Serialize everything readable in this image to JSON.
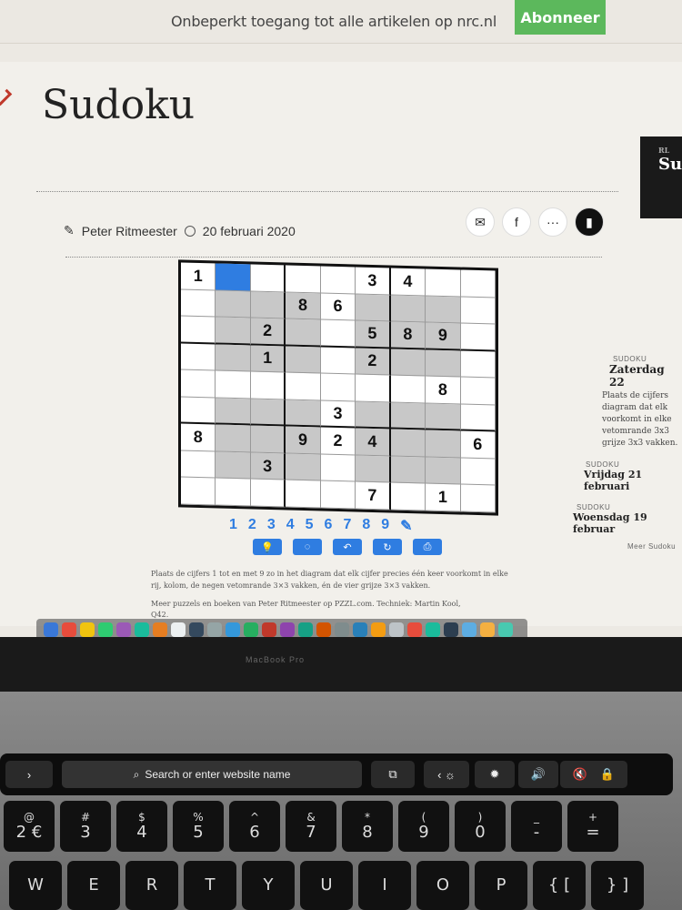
{
  "promo": {
    "text": "Onbeperkt toegang tot alle artikelen op nrc.nl",
    "button": "Abonneer"
  },
  "article": {
    "title": "Sudoku",
    "author": "Peter Ritmeester",
    "date": "20 februari 2020"
  },
  "share": {
    "mail": "✉",
    "facebook": "f",
    "more": "···",
    "bookmark": "▮"
  },
  "sudoku": {
    "cells": [
      [
        "1",
        "",
        "",
        "",
        "",
        "3",
        "4",
        "",
        ""
      ],
      [
        "",
        "",
        "",
        "8",
        "6",
        "",
        "",
        "",
        ""
      ],
      [
        "",
        "",
        "2",
        "",
        "",
        "5",
        "8",
        "9",
        ""
      ],
      [
        "",
        "",
        "1",
        "",
        "",
        "2",
        "",
        "",
        ""
      ],
      [
        "",
        "",
        "",
        "",
        "",
        "",
        "",
        "8",
        ""
      ],
      [
        "",
        "",
        "",
        "",
        "3",
        "",
        "",
        "",
        ""
      ],
      [
        "8",
        "",
        "",
        "9",
        "2",
        "4",
        "",
        "",
        "6"
      ],
      [
        "",
        "",
        "3",
        "",
        "",
        "",
        "",
        "",
        ""
      ],
      [
        "",
        "",
        "",
        "",
        "",
        "7",
        "",
        "1",
        ""
      ]
    ],
    "digits": [
      "1",
      "2",
      "3",
      "4",
      "5",
      "6",
      "7",
      "8",
      "9",
      "✎"
    ],
    "tools": [
      "💡",
      "◌",
      "↶",
      "↻",
      "⎙"
    ]
  },
  "instructions": "Plaats de cijfers 1 tot en met 9 zo in het diagram dat elk cijfer precies één keer voorkomt in elke rij, kolom, de negen vetomrande 3×3 vakken, én de vier grijze 3×3 vakken.",
  "more": "Meer puzzels en boeken van Peter Ritmeester op PZZL.com. Techniek: Martin Kool, Q42.",
  "rail": {
    "card": "Su",
    "card_label": "RL",
    "items": [
      {
        "label": "SUDOKU",
        "title": "Zaterdag 22",
        "desc": "Plaats de cijfers diagram dat elk voorkomt in elke vetomrande 3x3 grijze 3x3 vakken."
      },
      {
        "label": "SUDOKU",
        "title": "Vrijdag 21 februari"
      },
      {
        "label": "SUDOKU",
        "title": "Woensdag 19 februar"
      }
    ],
    "more": "Meer Sudoku"
  },
  "laptop": {
    "brand": "MacBook Pro"
  },
  "touchbar": {
    "search": "Search or enter website name"
  },
  "keyboard": {
    "row1": [
      {
        "top": "@",
        "bot": "2 €"
      },
      {
        "top": "#",
        "bot": "3"
      },
      {
        "top": "$",
        "bot": "4"
      },
      {
        "top": "%",
        "bot": "5"
      },
      {
        "top": "^",
        "bot": "6"
      },
      {
        "top": "&",
        "bot": "7"
      },
      {
        "top": "*",
        "bot": "8"
      },
      {
        "top": "(",
        "bot": "9"
      },
      {
        "top": ")",
        "bot": "0"
      },
      {
        "top": "_",
        "bot": "-"
      },
      {
        "top": "+",
        "bot": "="
      }
    ],
    "row2": [
      "W",
      "E",
      "R",
      "T",
      "Y",
      "U",
      "I",
      "O",
      "P",
      "{ [",
      "} ]"
    ]
  }
}
